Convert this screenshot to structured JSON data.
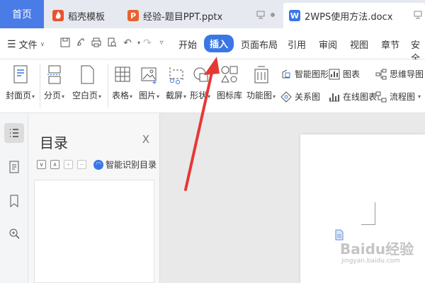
{
  "tabs": {
    "home": "首页",
    "items": [
      {
        "label": "稻壳模板",
        "icon_letter": "",
        "icon_color": "#e8532f"
      },
      {
        "label": "经验-题目PPT.pptx",
        "icon_letter": "P",
        "icon_color": "#e8632f"
      },
      {
        "label": "2WPS使用方法.docx",
        "icon_letter": "W",
        "icon_color": "#3a76e6"
      }
    ]
  },
  "menu": {
    "file": "文件",
    "items": [
      "开始",
      "插入",
      "页面布局",
      "引用",
      "审阅",
      "视图",
      "章节",
      "安全"
    ],
    "active": "插入"
  },
  "ribbon": {
    "cover": "封面页",
    "pagebreak": "分页",
    "blank": "空白页",
    "table": "表格",
    "picture": "图片",
    "screenshot": "截屏",
    "shape": "形状",
    "iconlib": "图标库",
    "funcchart": "功能图",
    "smartart": "智能图形",
    "chart": "图表",
    "mindmap": "思维导图",
    "relation": "关系图",
    "onlinechart": "在线图表",
    "flowchart": "流程图"
  },
  "toc": {
    "title": "目录",
    "close": "X",
    "ai_label": "智能识别目录"
  },
  "watermark": {
    "brand": "Baidu经验",
    "url": "jingyan.baidu.com"
  },
  "colors": {
    "accent": "#3a76e6",
    "home_tab": "#4a7ce8",
    "arrow": "#e53935"
  }
}
